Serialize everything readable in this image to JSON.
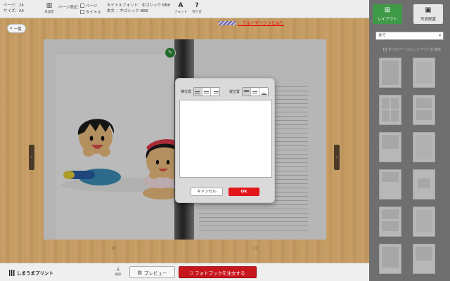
{
  "toolbar": {
    "info": {
      "page": "ページ：24",
      "size": "サイズ：A5"
    },
    "settings_label": "本設定",
    "page_display_label": "ページ表記：",
    "check_page": "ページ",
    "check_title": "タイトル",
    "title_font": "タイトルフォント：中ゴシック BBB",
    "body_font": "本文 ：中ゴシック BBB",
    "font_label": "フォント",
    "help_label": "作り方"
  },
  "workspace": {
    "back_label": "一覧",
    "margin_note": "：フルーマージンとは？",
    "left_page_number": "16",
    "right_page_number": "17",
    "edit_badge": "✎"
  },
  "dialog": {
    "horizontal_label": "横位置",
    "vertical_label": "縦位置",
    "text_value": "",
    "cancel_label": "キャンセル",
    "ok_label": "OK"
  },
  "bottombar": {
    "brand": "しまうまプリント",
    "save_label": "保存",
    "preview_label": "プレビュー",
    "order_label": "フォトブックを注文する"
  },
  "sidebar": {
    "tab_layout": "レイアウト",
    "tab_photo": "写真配置",
    "filter_value": "全て",
    "apply_all_label": "全てのページにレイアウトを適用"
  },
  "colors": {
    "accent_green": "#3f9a48",
    "order_red": "#c8161d",
    "ok_red": "#e3151a"
  },
  "icons": {
    "book": "book-icon",
    "font": "font-icon",
    "help": "question-icon",
    "back": "search-back-icon",
    "save": "save-icon",
    "preview": "preview-icon",
    "order": "order-icon",
    "layout": "layout-grid-icon",
    "photo": "photo-icon"
  }
}
